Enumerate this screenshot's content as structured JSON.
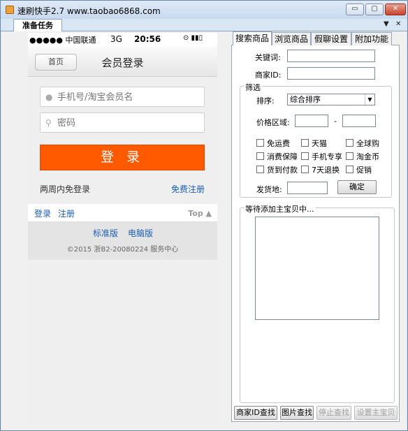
{
  "window": {
    "title": "速刷快手2.7 www.taobao6868.com",
    "min_label": "▭",
    "max_label": "▢",
    "close_label": "✕"
  },
  "tabstrip": {
    "active_tab": "准备任务",
    "dropdown_glyph": "▼",
    "close_glyph": "✕"
  },
  "phone": {
    "status": {
      "carrier": "●●●●● 中国联通",
      "network": "3G",
      "time": "20:56",
      "right": "⊙ ▮▮▯"
    },
    "nav": {
      "back_label": "首页",
      "title": "会员登录"
    },
    "username_placeholder": "手机号/淘宝会员名",
    "password_placeholder": "密码",
    "login_label": "登 录",
    "remember_label": "两周内免登录",
    "register_label": "免费注册",
    "footer": {
      "login": "登录",
      "register": "注册",
      "top": "Top ▲",
      "standard": "标准版",
      "pc": "电脑版",
      "copyright": "©2015 浙B2-20080224   服务中心"
    }
  },
  "right": {
    "tabs": [
      "搜索商品",
      "浏览商品",
      "假聊设置",
      "附加功能"
    ],
    "keyword_label": "关键词:",
    "shopid_label": "商家ID:",
    "filter_group": "筛选",
    "sort_label": "排序:",
    "sort_value": "综合排序",
    "price_label": "价格区域:",
    "price_dash": "-",
    "checkboxes": [
      [
        "免运费",
        "天猫",
        "全球购"
      ],
      [
        "消费保障",
        "手机专享",
        "淘金币"
      ],
      [
        "货到付款",
        "7天退换",
        "促销"
      ]
    ],
    "ship_label": "发货地:",
    "confirm_label": "确定",
    "waiting_group": "等待添加主宝贝中...",
    "buttons": [
      "商家ID查找",
      "图片查找",
      "停止查找",
      "设置主宝贝"
    ]
  }
}
